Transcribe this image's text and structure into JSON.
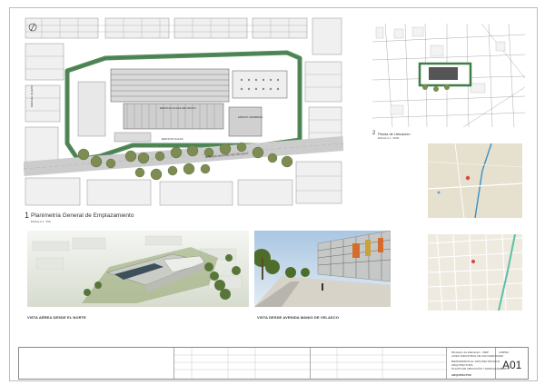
{
  "drawings": {
    "site_plan": {
      "number": "1",
      "title": "Planimetría General de Emplazamiento",
      "scale": "ESCALA 1 : 500"
    },
    "location_plan": {
      "number": "2",
      "title": "Planta de Ubicación",
      "scale": "ESCALA 1 : 5000"
    }
  },
  "plan_labels": {
    "street_south": "AVENIDA MARIANO DE VELASCO",
    "street_west": "MANUEL QUEITA",
    "building_a": "EDIFICIO AULAS DE OFICIO",
    "building_b": "EDIFICIO AULAS",
    "building_c": "EDIFICIO GRADERIAS"
  },
  "renders": [
    {
      "caption": "VISTA AÉREA DESDE EL NORTE"
    },
    {
      "caption": "VISTA DESDE AVENIDA MANIO DE VELASCO"
    }
  ],
  "title_block": {
    "client_line1": "Ministerio de Educación - MEP",
    "client_line2": "LICEO INDUSTRIAL DE SAN FERNANDO",
    "project_line1": "BIENVENIDOS AL DIPLOMA TÉCNICO",
    "project_line2": "ARQUITECTURA",
    "project_line3": "PLANTA DE UBICACIÓN Y EMPLAZAMIENTO",
    "firm": "ARQUITECTOS",
    "sheet_label": "LAMINA",
    "sheet_number": "A01"
  },
  "colors": {
    "hedge": "#3f7d46",
    "tree": "#7d8c52",
    "map_bg": "#e6e0cf"
  }
}
